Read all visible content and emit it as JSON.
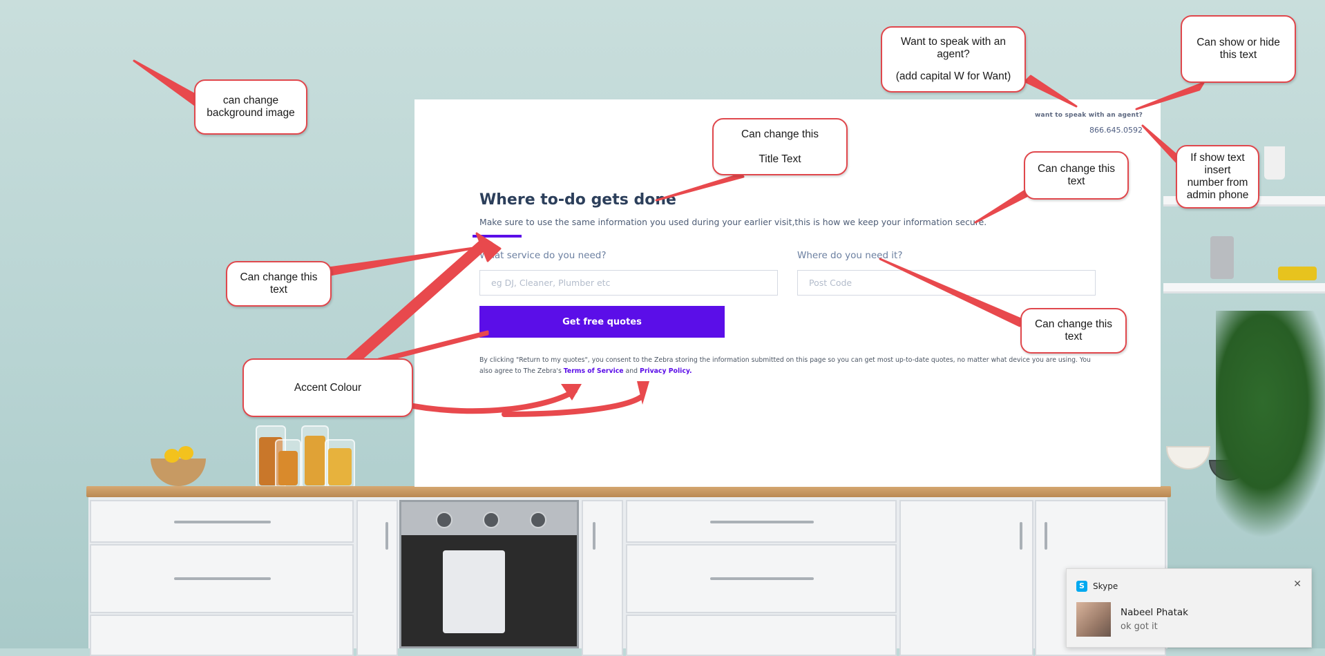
{
  "form": {
    "agent_prompt": "want to speak with an agent?",
    "agent_phone": "866.645.0592",
    "title": "Where to-do gets done",
    "subtitle": "Make sure to use the same information you used during your earlier visit,this is how we keep your information secure.",
    "service_label": "What service do you need?",
    "service_placeholder": "eg DJ, Cleaner, Plumber etc",
    "location_label": "Where do you need it?",
    "location_placeholder": "Post Code",
    "cta_label": "Get free quotes",
    "consent_text": "By clicking \"Return to my quotes\", you consent to the Zebra storing the information submitted on this page so you can get most up-to-date quotes, no matter what device you are using. You also agree to The Zebra's",
    "terms_label": "Terms of Service",
    "consent_and": "and",
    "privacy_label": "Privacy Policy.",
    "accent_color": "#5b0ee8"
  },
  "callouts": {
    "background": [
      "can change",
      "background image"
    ],
    "speak_agent": [
      "Want to speak with an",
      "agent?",
      "",
      "(add capital W for Want)"
    ],
    "show_hide": [
      "Can show or hide",
      "this text"
    ],
    "phone_number": [
      "If show text",
      "insert",
      "number from",
      "admin phone"
    ],
    "title_text": [
      "Can change this",
      "",
      "Title Text"
    ],
    "subtitle_text": [
      "Can change this",
      "text"
    ],
    "service_label": [
      "Can change this",
      "text"
    ],
    "location_label": [
      "Can change this",
      "text"
    ],
    "accent": [
      "Accent Colour"
    ]
  },
  "notification": {
    "app": "Skype",
    "app_icon": "S",
    "sender": "Nabeel Phatak",
    "message": "ok got it",
    "close_icon": "✕"
  }
}
